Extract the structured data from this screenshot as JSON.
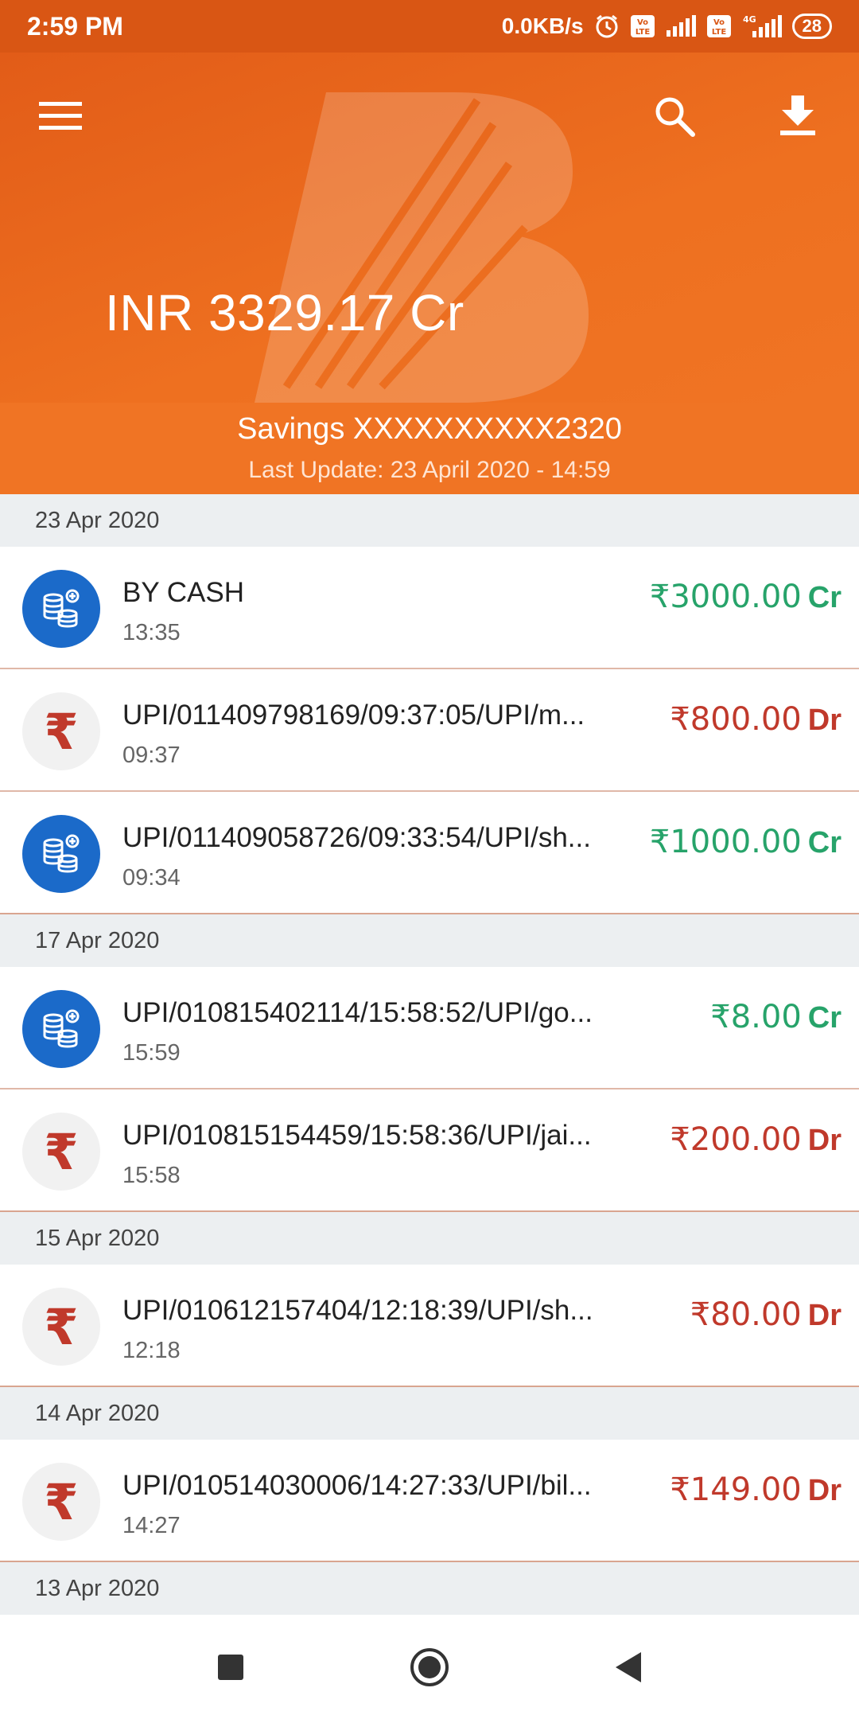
{
  "status_bar": {
    "time": "2:59 PM",
    "network_speed": "0.0KB/s",
    "battery": "28",
    "icons": [
      "alarm-icon",
      "volte-icon",
      "signal-icon",
      "volte-icon",
      "4g-signal-icon",
      "battery-icon"
    ]
  },
  "header": {
    "menu_icon": "hamburger-menu-icon",
    "search_icon": "search-icon",
    "download_icon": "download-icon",
    "logo": "bank-of-baroda-logo",
    "balance": "INR 3329.17 Cr"
  },
  "account": {
    "name": "Savings XXXXXXXXXX2320",
    "last_update": "Last Update: 23 April 2020 - 14:59"
  },
  "transaction_groups": [
    {
      "date": "23 Apr 2020",
      "transactions": [
        {
          "type": "credit",
          "icon": "coins-icon",
          "description": "BY CASH",
          "time": "13:35",
          "amount": "₹3000.00",
          "indicator": "Cr"
        },
        {
          "type": "debit",
          "icon": "rupee-icon",
          "description": "UPI/011409798169/09:37:05/UPI/m...",
          "time": "09:37",
          "amount": "₹800.00",
          "indicator": "Dr"
        },
        {
          "type": "credit",
          "icon": "coins-icon",
          "description": "UPI/011409058726/09:33:54/UPI/sh...",
          "time": "09:34",
          "amount": "₹1000.00",
          "indicator": "Cr"
        }
      ]
    },
    {
      "date": "17 Apr 2020",
      "transactions": [
        {
          "type": "credit",
          "icon": "coins-icon",
          "description": "UPI/010815402114/15:58:52/UPI/go...",
          "time": "15:59",
          "amount": "₹8.00",
          "indicator": "Cr"
        },
        {
          "type": "debit",
          "icon": "rupee-icon",
          "description": "UPI/010815154459/15:58:36/UPI/jai...",
          "time": "15:58",
          "amount": "₹200.00",
          "indicator": "Dr"
        }
      ]
    },
    {
      "date": "15 Apr 2020",
      "transactions": [
        {
          "type": "debit",
          "icon": "rupee-icon",
          "description": "UPI/010612157404/12:18:39/UPI/sh...",
          "time": "12:18",
          "amount": "₹80.00",
          "indicator": "Dr"
        }
      ]
    },
    {
      "date": "14 Apr 2020",
      "transactions": [
        {
          "type": "debit",
          "icon": "rupee-icon",
          "description": "UPI/010514030006/14:27:33/UPI/bil...",
          "time": "14:27",
          "amount": "₹149.00",
          "indicator": "Dr"
        }
      ]
    },
    {
      "date": "13 Apr 2020",
      "transactions": []
    }
  ],
  "colors": {
    "header_orange": "#e25c18",
    "strip_orange": "#f07424",
    "credit_green": "#27a36a",
    "debit_red": "#c0392b",
    "credit_icon_blue": "#1b6ac9"
  },
  "nav_bar": {
    "recents_icon": "square-recents-icon",
    "home_icon": "circle-home-icon",
    "back_icon": "triangle-back-icon"
  }
}
